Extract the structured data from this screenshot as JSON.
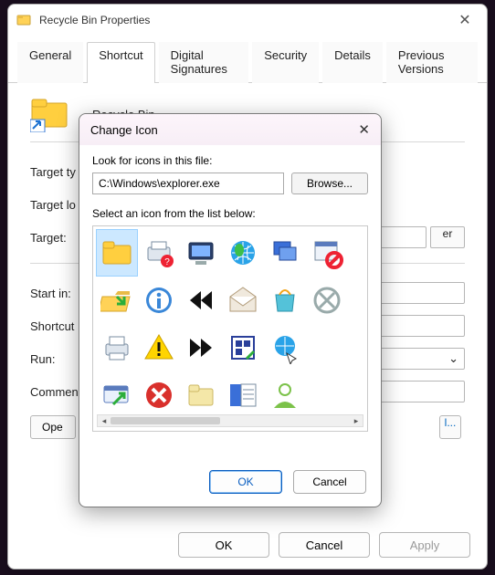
{
  "window": {
    "title": "Recycle Bin Properties",
    "close_glyph": "✕"
  },
  "tabs": [
    {
      "label": "General"
    },
    {
      "label": "Shortcut"
    },
    {
      "label": "Digital Signatures"
    },
    {
      "label": "Security"
    },
    {
      "label": "Details"
    },
    {
      "label": "Previous Versions"
    }
  ],
  "active_tab": 1,
  "header": {
    "name": "Recycle Bin"
  },
  "labels": {
    "target_type": "Target ty",
    "target_location": "Target lo",
    "target": "Target:",
    "start_in": "Start in:",
    "shortcut_key": "Shortcut",
    "run": "Run:",
    "comment": "Commen"
  },
  "fields": {
    "target_suffix": "er",
    "run_caret": "⌄"
  },
  "bottom_buttons": {
    "open_location": "Ope",
    "right_ellipsis": "l..."
  },
  "footer": {
    "ok": "OK",
    "cancel": "Cancel",
    "apply": "Apply"
  },
  "modal": {
    "title": "Change Icon",
    "close_glyph": "✕",
    "look_label": "Look for icons in this file:",
    "path_value": "C:\\Windows\\explorer.exe",
    "browse": "Browse...",
    "select_label": "Select an icon from the list below:",
    "icons": [
      "folder-icon",
      "printer-help-icon",
      "computer-display-icon",
      "globe-icon",
      "windows-cascade-icon",
      "window-blocked-icon",
      "folder-open-icon",
      "info-icon",
      "rewind-icon",
      "mail-open-icon",
      "shopping-bag-icon",
      "cancel-circle-icon",
      "printer-icon",
      "warning-icon",
      "forward-icon",
      "app-board-icon",
      "globe-pointer-icon",
      "",
      "monitor-arrow-icon",
      "error-circle-icon",
      "folder-plain-icon",
      "list-panel-icon",
      "user-green-icon",
      ""
    ],
    "selected_index": 0,
    "ok": "OK",
    "cancel": "Cancel",
    "scroll": {
      "left": "◂",
      "right": "▸"
    }
  }
}
